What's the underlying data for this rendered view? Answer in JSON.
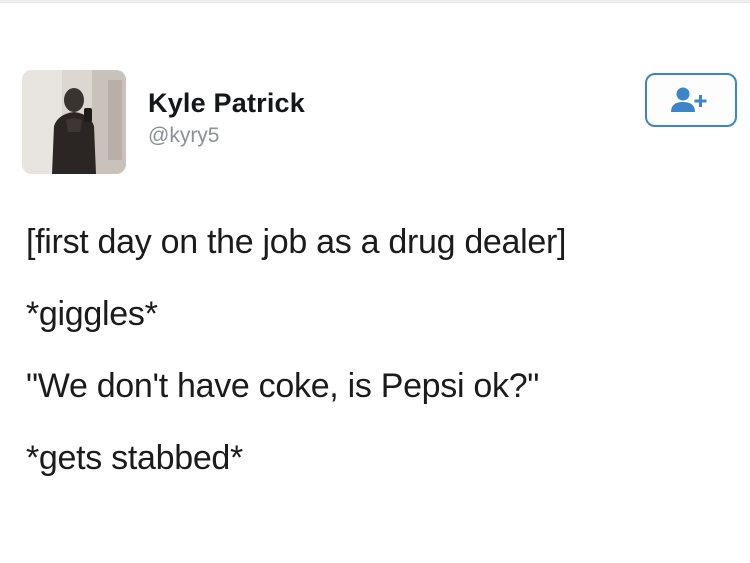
{
  "user": {
    "display_name": "Kyle Patrick",
    "handle": "@kyry5"
  },
  "follow_button": {
    "icon": "add-user-icon"
  },
  "tweet": {
    "lines": [
      "[first day on the job as a drug dealer]",
      "*giggles*",
      "\"We don't have coke, is Pepsi ok?\"",
      "*gets stabbed*"
    ]
  },
  "colors": {
    "accent": "#3b86c8",
    "name": "#14171a",
    "handle": "#8a9097",
    "text": "#1b1b1b"
  }
}
